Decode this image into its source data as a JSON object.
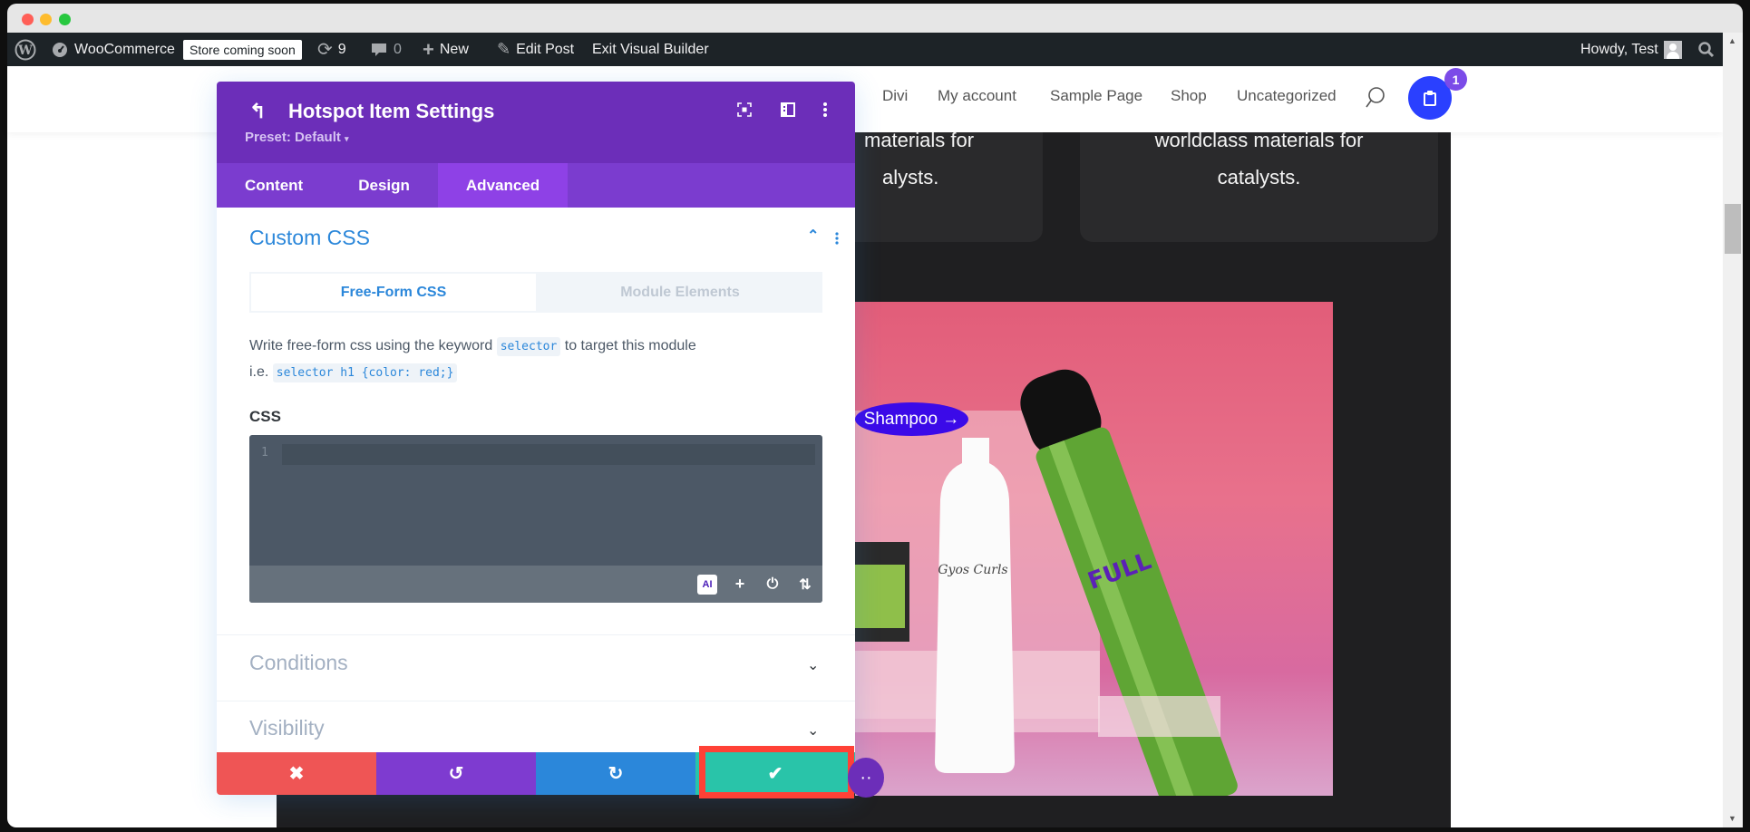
{
  "browser": {
    "traffic_lights": [
      "close",
      "minimize",
      "maximize"
    ]
  },
  "admin_bar": {
    "site_name": "WooCommerce",
    "store_badge": "Store coming soon",
    "updates_count": "9",
    "comments_count": "0",
    "new_label": "New",
    "edit_post_label": "Exit Visual Builder",
    "edit_label": "Edit Post",
    "exit_label": "Exit Visual Builder",
    "howdy": "Howdy, Test"
  },
  "site_nav": {
    "items": [
      "Divi",
      "My account",
      "Sample Page",
      "Shop",
      "Uncategorized"
    ],
    "cart_count": "1"
  },
  "page": {
    "card_left_lines": [
      "materials for",
      "alysts."
    ],
    "card_right_lines": [
      "worldclass materials for",
      "catalysts."
    ],
    "hotspot_label": "Shampoo →"
  },
  "panel": {
    "title": "Hotspot Item Settings",
    "preset": "Preset: Default",
    "tabs": [
      {
        "label": "Content",
        "active": false
      },
      {
        "label": "Design",
        "active": false
      },
      {
        "label": "Advanced",
        "active": true
      }
    ],
    "section_title": "Custom CSS",
    "subtabs": [
      {
        "label": "Free-Form CSS",
        "active": true
      },
      {
        "label": "Module Elements",
        "active": false
      }
    ],
    "description_prefix": "Write free-form css using the keyword",
    "description_keyword": "selector",
    "description_suffix": "to target this module",
    "example_prefix": "i.e.",
    "example_code": "selector h1 {color: red;}",
    "css_label": "CSS",
    "editor_line_number": "1",
    "editor_value": "",
    "editor_tools": [
      "ai",
      "add",
      "power",
      "sort"
    ],
    "ai_label": "AI",
    "collapsed_sections": [
      "Conditions",
      "Visibility"
    ]
  },
  "footer": {
    "buttons": [
      {
        "name": "discard",
        "icon": "✖",
        "color": "#ef5555"
      },
      {
        "name": "undo",
        "icon": "↺",
        "color": "#7e3bd0"
      },
      {
        "name": "redo",
        "icon": "↻",
        "color": "#2b87da"
      },
      {
        "name": "save",
        "icon": "✔",
        "color": "#29c4a9"
      }
    ]
  },
  "colors": {
    "panel_header": "#6c2eb9",
    "tabs_bg": "#7b3ccf",
    "tab_active": "#8e41e6",
    "accent_blue": "#2b87da",
    "highlight_red": "#ff4136"
  }
}
